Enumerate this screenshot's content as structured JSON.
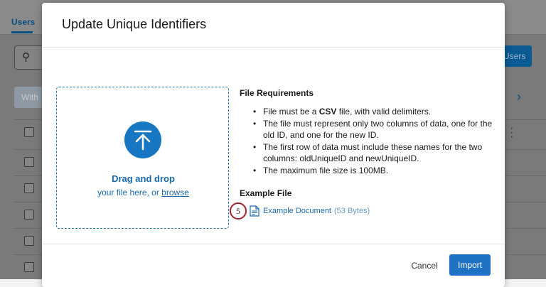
{
  "background": {
    "tab_label": "Users",
    "users_button_label": "Users",
    "with_button_label": "With"
  },
  "modal": {
    "title": "Update Unique Identifiers",
    "dropzone": {
      "title": "Drag and drop",
      "subtitle_prefix": "your file here, or ",
      "browse_label": "browse"
    },
    "requirements": {
      "title": "File Requirements",
      "items": [
        {
          "before": "File must be a ",
          "bold": "CSV",
          "after": " file, with valid delimiters."
        },
        {
          "before": "The file must represent only two columns of data, one for the old ID, and one for the new ID.",
          "bold": "",
          "after": ""
        },
        {
          "before": "The first row of data must include these names for the two columns: oldUniqueID and newUniqueID.",
          "bold": "",
          "after": ""
        },
        {
          "before": "The maximum file size is 100MB.",
          "bold": "",
          "after": ""
        }
      ]
    },
    "example": {
      "title": "Example File",
      "link_label": "Example Document",
      "size": "(53 Bytes)"
    },
    "step_badge": "5",
    "cancel_label": "Cancel",
    "import_label": "Import"
  },
  "colors": {
    "accent": "#1f72c3",
    "badge_ring": "#a4222c"
  }
}
